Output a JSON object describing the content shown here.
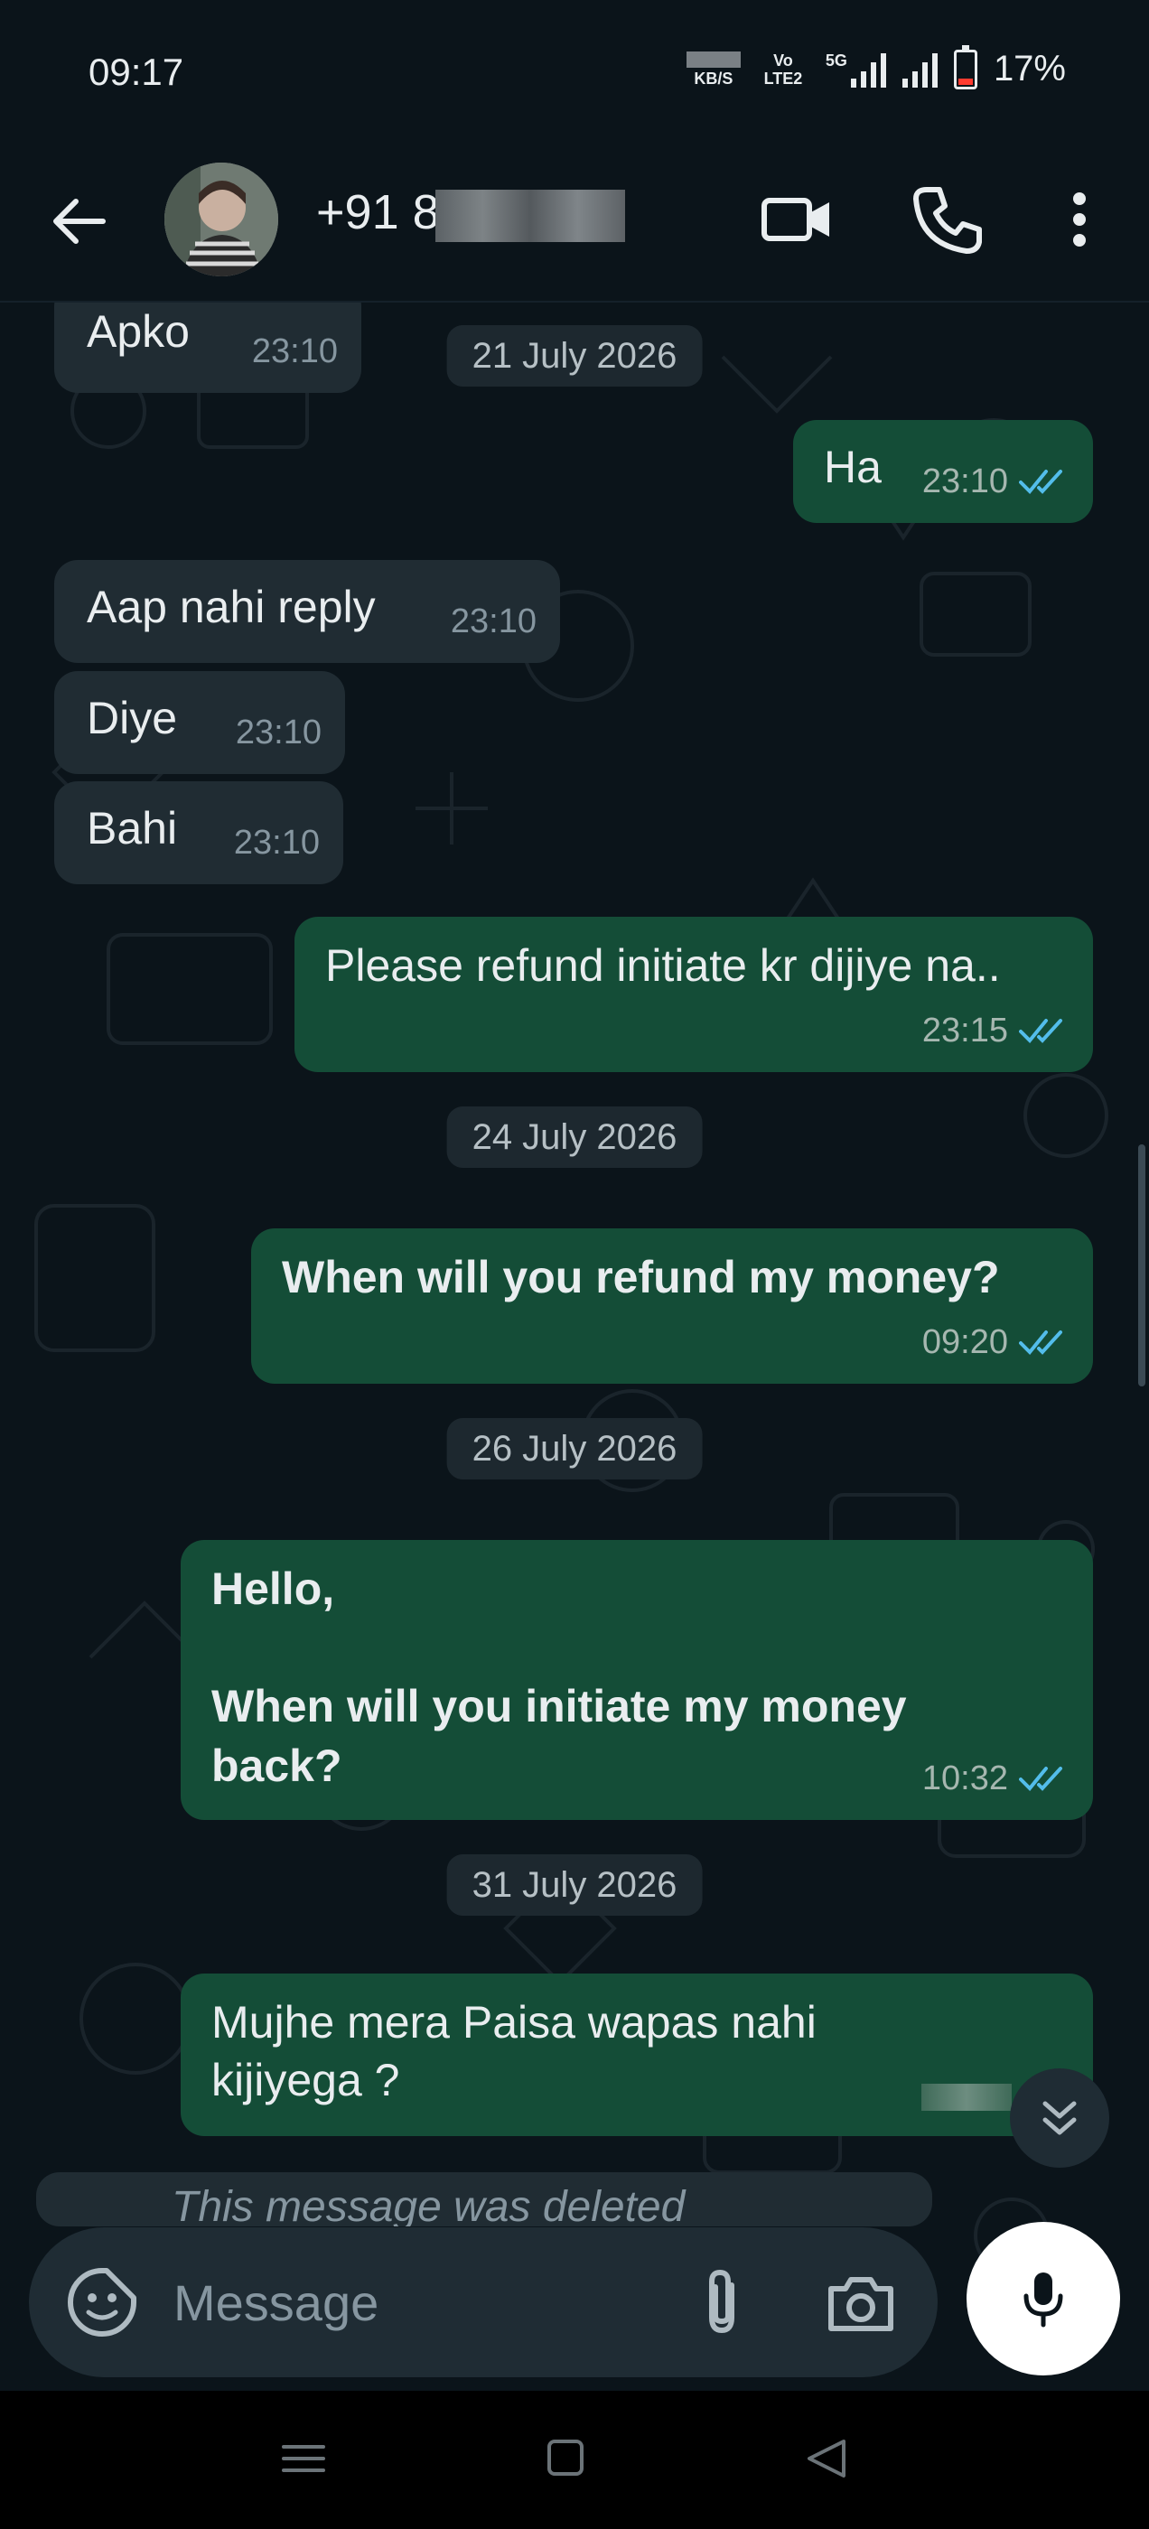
{
  "status_bar": {
    "time": "09:17",
    "net_speed_unit": "KB/S",
    "volte_label": "Vo LTE2",
    "network": "5G",
    "battery_percent": "17%",
    "battery_level": 0.17
  },
  "header": {
    "contact_name": "+91 8          27..."
  },
  "chat": {
    "messages": [
      {
        "dir": "in",
        "text": "Apko",
        "time": "23:10"
      },
      {
        "dir": "out",
        "text": "Ha",
        "time": "23:10"
      },
      {
        "dir": "in",
        "text": "Aap nahi reply",
        "time": "23:10"
      },
      {
        "dir": "in",
        "text": "Diye",
        "time": "23:10"
      },
      {
        "dir": "in",
        "text": "Bahi",
        "time": "23:10"
      },
      {
        "dir": "out",
        "text": "Please refund initiate kr dijiye na..",
        "time": "23:15"
      },
      {
        "dir": "out",
        "text": "When will you refund my money?",
        "time": "09:20"
      },
      {
        "dir": "out",
        "text_line1": "Hello,",
        "text_line2": "When will you initiate my money",
        "text_line3": "back?",
        "time": "10:32"
      },
      {
        "dir": "out",
        "text_line1": "Mujhe mera Paisa wapas nahi",
        "text_line2": "kijiyega ?",
        "time": ""
      }
    ],
    "dates": [
      "21 July 2026",
      "24 July 2026",
      "26 July 2026",
      "31 July 2026"
    ],
    "deleted_peek": "This message was deleted"
  },
  "input": {
    "placeholder": "Message"
  },
  "colors": {
    "background": "#0b141a",
    "incoming_bubble": "#202c33",
    "outgoing_bubble": "#144d37",
    "read_ticks": "#53bdeb"
  }
}
